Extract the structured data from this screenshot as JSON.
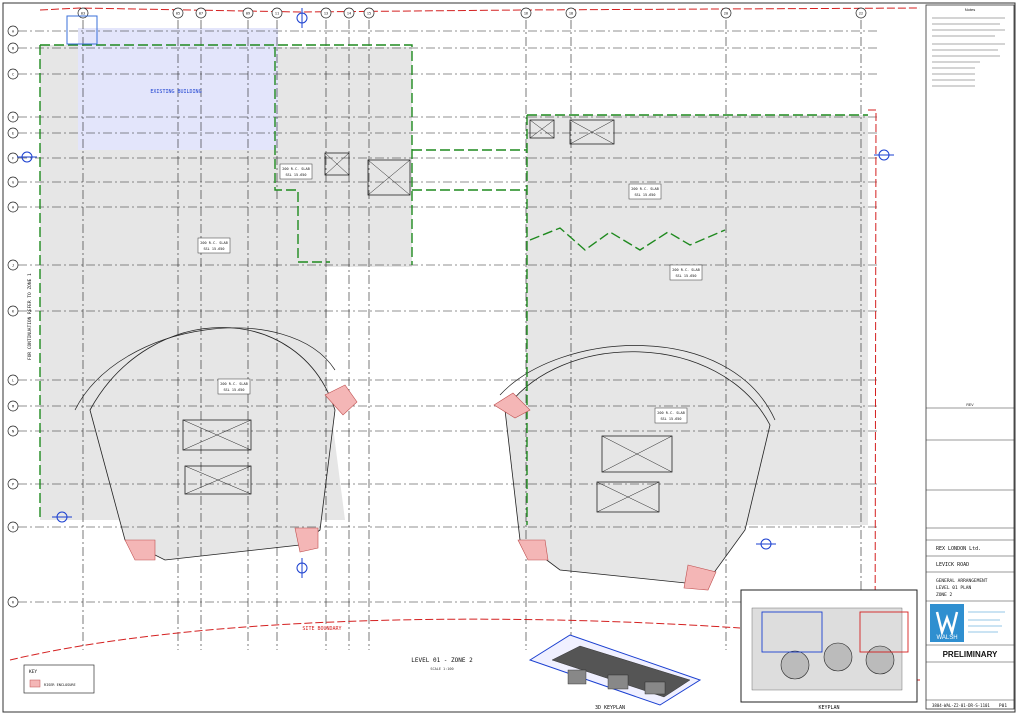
{
  "labels": {
    "existing_building": "EXISTING BUILDING",
    "site_boundary": "SITE BOUNDARY",
    "drawing_title": "LEVEL 01 - ZONE 2",
    "drawing_scale": "SCALE 1:100",
    "keyplan_3d": "3D KEYPLAN",
    "keyplan": "KEYPLAN",
    "side_note": "FOR CONTINUATION REFER TO ZONE 1"
  },
  "slab_tags": [
    {
      "line1": "200 R.C. SLAB",
      "line2": "SSL 15.650"
    },
    {
      "line1": "200 R.C. SLAB",
      "line2": "SSL 15.650"
    },
    {
      "line1": "200 R.C. SLAB",
      "line2": "SSL 15.650"
    },
    {
      "line1": "200 R.C. SLAB",
      "line2": "SSL 15.650"
    },
    {
      "line1": "200 R.C. SLAB",
      "line2": "SSL 15.650"
    },
    {
      "line1": "200 R.C. SLAB",
      "line2": "SSL 15.650"
    }
  ],
  "grid_col_labels": [
    "03",
    "05",
    "07",
    "09",
    "11",
    "13",
    "14",
    "15",
    "16",
    "18",
    "20",
    "22",
    "24"
  ],
  "grid_row_labels": [
    "A",
    "B",
    "C",
    "D",
    "E",
    "F",
    "G",
    "H",
    "J",
    "K",
    "L",
    "M",
    "N",
    "P",
    "Q",
    "R",
    "S",
    "T"
  ],
  "legend": {
    "title": "KEY",
    "items": [
      {
        "label": "RISER ENCLOSURE",
        "color": "#f4b6b6"
      }
    ]
  },
  "title_block": {
    "notes_heading": "Notes",
    "revision_heading": "REV",
    "client": "REX LONDON Ltd.",
    "project": "LEVICK ROAD",
    "drawing_title_lines": [
      "GENERAL ARRANGEMENT",
      "LEVEL 01 PLAN",
      "ZONE 2"
    ],
    "company": "WALSH",
    "status": "PRELIMINARY",
    "drawing_number": "3804-WAL-Z2-01-DR-S-1101",
    "revision": "P01"
  },
  "colors": {
    "slab": "#e6e6e6",
    "existing": "#e3e5fb",
    "grid": "#222222",
    "structure": "#1f8a1f",
    "boundary": "#d42020",
    "riser": "#f4b6b6",
    "section_marker": "#1a3fd0"
  }
}
